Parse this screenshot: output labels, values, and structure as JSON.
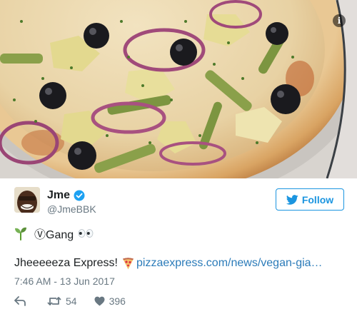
{
  "media": {
    "info_icon": "i"
  },
  "author": {
    "display_name": "Jme",
    "handle": "@JmeBBK",
    "verified": true
  },
  "follow_button": {
    "label": "Follow",
    "icon": "twitter-bird-icon"
  },
  "tweet": {
    "line1_text": "ⓋGang",
    "line1_icons": [
      "sprout-icon",
      "eyes-icon"
    ],
    "line2_text": "Jheeeeeza Express!",
    "line2_icon": "pizza-icon",
    "link_text": "pizzaexpress.com/news/vegan-gia…"
  },
  "timestamp": "7:46 AM - 13 Jun 2017",
  "actions": {
    "retweet_count": "54",
    "like_count": "396"
  },
  "colors": {
    "accent": "#1b95e0",
    "link": "#2b7bb9",
    "muted": "#697882",
    "text": "#1c2022"
  }
}
